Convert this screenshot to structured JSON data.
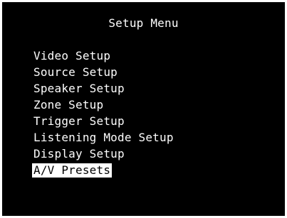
{
  "menu": {
    "title": "Setup Menu",
    "items": [
      {
        "label": "Video Setup",
        "selected": false
      },
      {
        "label": "Source Setup",
        "selected": false
      },
      {
        "label": "Speaker Setup",
        "selected": false
      },
      {
        "label": "Zone Setup",
        "selected": false
      },
      {
        "label": "Trigger Setup",
        "selected": false
      },
      {
        "label": "Listening Mode Setup",
        "selected": false
      },
      {
        "label": "Display Setup",
        "selected": false
      },
      {
        "label": "A/V Presets",
        "selected": true
      }
    ]
  },
  "colors": {
    "background": "#000000",
    "text": "#ffffff",
    "highlight_background": "#ffffff",
    "highlight_text": "#000000"
  }
}
